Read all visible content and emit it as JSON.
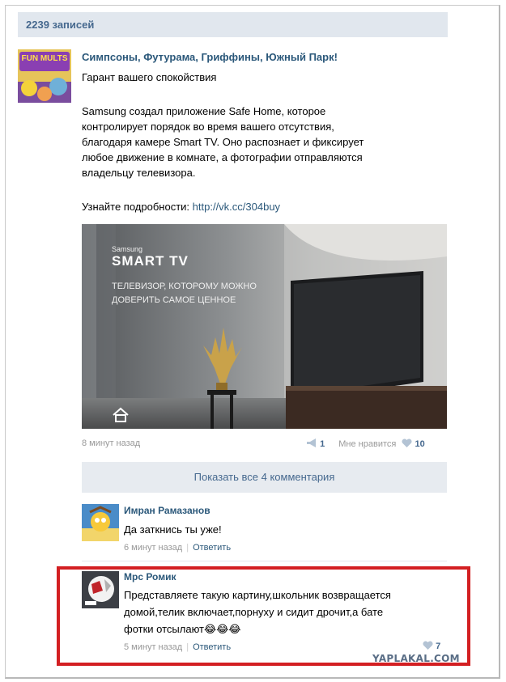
{
  "records": "2239 записей",
  "post": {
    "author": "Симпсоны, Футурама, Гриффины, Южный Парк!",
    "avatar_text": "FUN MULTS",
    "subtitle": "Гарант вашего спокойствия",
    "body": [
      "Samsung создал приложение Safe Home, которое",
      "контролирует порядок во время вашего отсутствия,",
      "благодаря камере Smart TV. Оно распознает и фиксирует",
      "любое движение в комнате, а фотографии отправляются",
      "владельцу телевизора."
    ],
    "more_label": "Узнайте подробности:",
    "link": "http://vk.cc/304buy",
    "image": {
      "brand": "Samsung",
      "logo": "SMART TV",
      "tagline_1": "ТЕЛЕВИЗОР, КОТОРОМУ МОЖНО",
      "tagline_2": "ДОВЕРИТЬ САМОЕ ЦЕННОЕ"
    },
    "time": "8 минут назад",
    "reposts": "1",
    "like_label": "Мне нравится",
    "likes": "10"
  },
  "show_comments": "Показать все 4 комментария",
  "comments": [
    {
      "name": "Имран Рамазанов",
      "text": [
        "Да заткнись ты уже!"
      ],
      "time": "6 минут назад",
      "reply": "Ответить"
    },
    {
      "name": "Мрс Ромик",
      "text": [
        "Представляете такую картину,школьник возвращается",
        "домой,телик включает,порнуху и сидит дрочит,а бате",
        "фотки отсылают"
      ],
      "emoji": "😂😂😂",
      "time": "5 минут назад",
      "reply": "Ответить",
      "likes": "7"
    }
  ],
  "watermark": "YAPLAKAL.COM",
  "colors": {
    "link": "#2b587a",
    "header_bg": "#e1e7ee",
    "highlight": "#d31f22"
  }
}
